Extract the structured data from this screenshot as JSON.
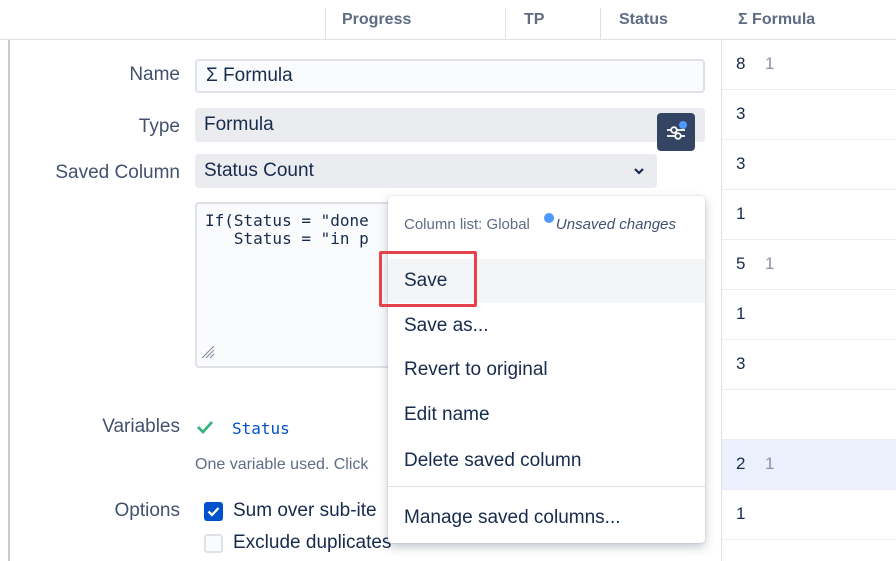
{
  "grid": {
    "columns": [
      "Progress",
      "TP",
      "Status",
      "Σ Formula"
    ],
    "rows": [
      {
        "value": "8",
        "sub": "1",
        "selected": false
      },
      {
        "value": "3",
        "sub": "",
        "selected": false
      },
      {
        "value": "3",
        "sub": "",
        "selected": false
      },
      {
        "value": "1",
        "sub": "",
        "selected": false
      },
      {
        "value": "5",
        "sub": "1",
        "selected": false
      },
      {
        "value": "1",
        "sub": "",
        "selected": false
      },
      {
        "value": "3",
        "sub": "",
        "selected": false
      },
      {
        "value": "",
        "sub": "",
        "selected": false
      },
      {
        "value": "2",
        "sub": "1",
        "selected": true
      },
      {
        "value": "1",
        "sub": "",
        "selected": false
      }
    ]
  },
  "form": {
    "name_label": "Name",
    "name_value": "Σ Formula",
    "type_label": "Type",
    "type_value": "Formula",
    "saved_column_label": "Saved Column",
    "saved_column_value": "Status Count",
    "formula_text": "If(Status = \"done\n   Status = \"in p",
    "variables_label": "Variables",
    "variable_name": "Status",
    "help_text": "One variable used. Click",
    "options_label": "Options",
    "option_sum": "Sum over sub-ite",
    "option_sum_checked": true,
    "option_exclude": "Exclude duplicates",
    "option_exclude_checked": false
  },
  "menu": {
    "header_prefix": "Column list: Global",
    "header_status": "Unsaved changes",
    "items": [
      "Save",
      "Save as...",
      "Revert to original",
      "Edit name",
      "Delete saved column"
    ],
    "manage_item": "Manage saved columns..."
  },
  "colors": {
    "accent": "#0052cc",
    "highlight": "#e5434b",
    "success": "#36b37e",
    "unsaved_dot": "#4c9aff"
  }
}
